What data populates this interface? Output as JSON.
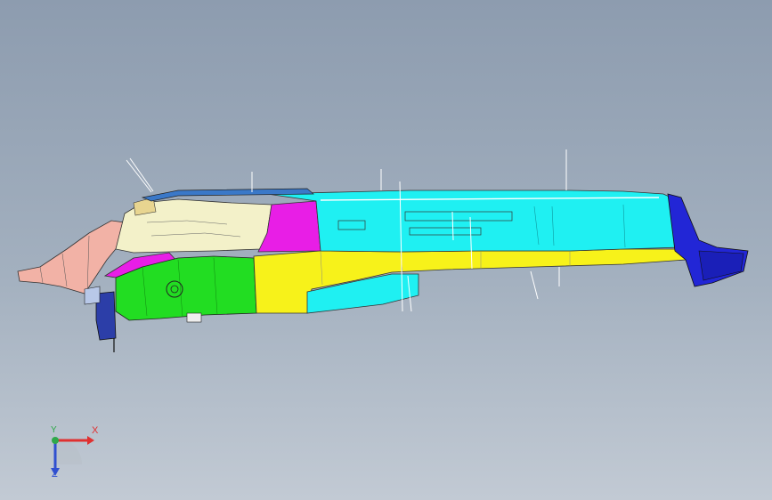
{
  "viewport": {
    "background_top": "#8d9caf",
    "background_bottom": "#c2cad4"
  },
  "model": {
    "part_colors": {
      "salmon": "#f2b2a6",
      "cream": "#f3f1c9",
      "magenta": "#e81ee6",
      "green": "#22dd22",
      "yellow": "#f7f21a",
      "cyan": "#1ff0f2",
      "blue": "#2226d6",
      "steel_blue": "#3a78c8"
    }
  },
  "triad": {
    "x_label": "X",
    "y_label": "Y",
    "z_label": "Z",
    "x_color": "#e03030",
    "y_color": "#2fa84a",
    "z_color": "#3050d0"
  }
}
